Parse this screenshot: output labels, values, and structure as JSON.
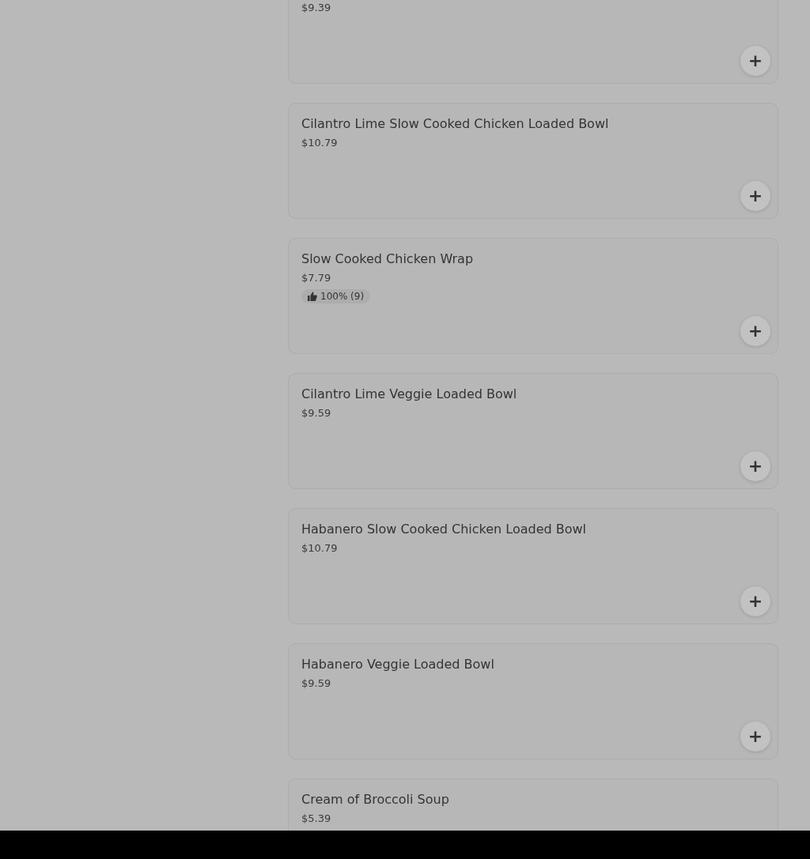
{
  "menu_items": [
    {
      "price": "$9.39",
      "add_label": "+"
    },
    {
      "title": "Cilantro Lime Slow Cooked Chicken Loaded Bowl",
      "price": "$10.79",
      "add_label": "+"
    },
    {
      "title": "Slow Cooked Chicken Wrap",
      "price": "$7.79",
      "rating": "100% (9)",
      "add_label": "+"
    },
    {
      "title": "Cilantro Lime Veggie Loaded Bowl",
      "price": "$9.59",
      "add_label": "+"
    },
    {
      "title": "Habanero Slow Cooked Chicken Loaded Bowl",
      "price": "$10.79",
      "add_label": "+"
    },
    {
      "title": "Habanero Veggie Loaded Bowl",
      "price": "$9.59",
      "add_label": "+"
    },
    {
      "title": "Cream of Broccoli Soup",
      "price": "$5.39"
    }
  ]
}
